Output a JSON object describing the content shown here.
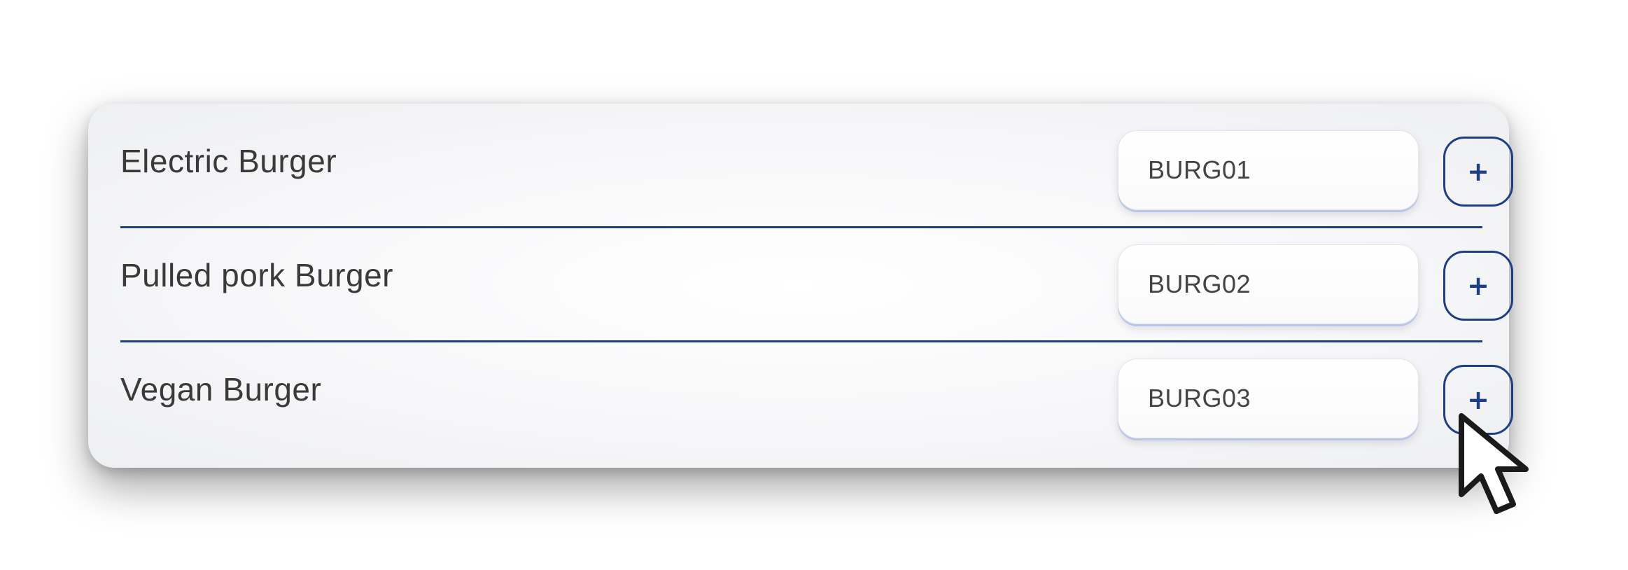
{
  "items": [
    {
      "name": "Electric Burger",
      "code": "BURG01",
      "add_label": "+"
    },
    {
      "name": "Pulled pork Burger",
      "code": "BURG02",
      "add_label": "+"
    },
    {
      "name": "Vegan Burger",
      "code": "BURG03",
      "add_label": "+"
    }
  ],
  "icons": {
    "cursor": "mouse-pointer-icon"
  },
  "colors": {
    "accent": "#1d3f8a",
    "text": "#3a3a3a",
    "card_bg": "#f7f7f9"
  }
}
